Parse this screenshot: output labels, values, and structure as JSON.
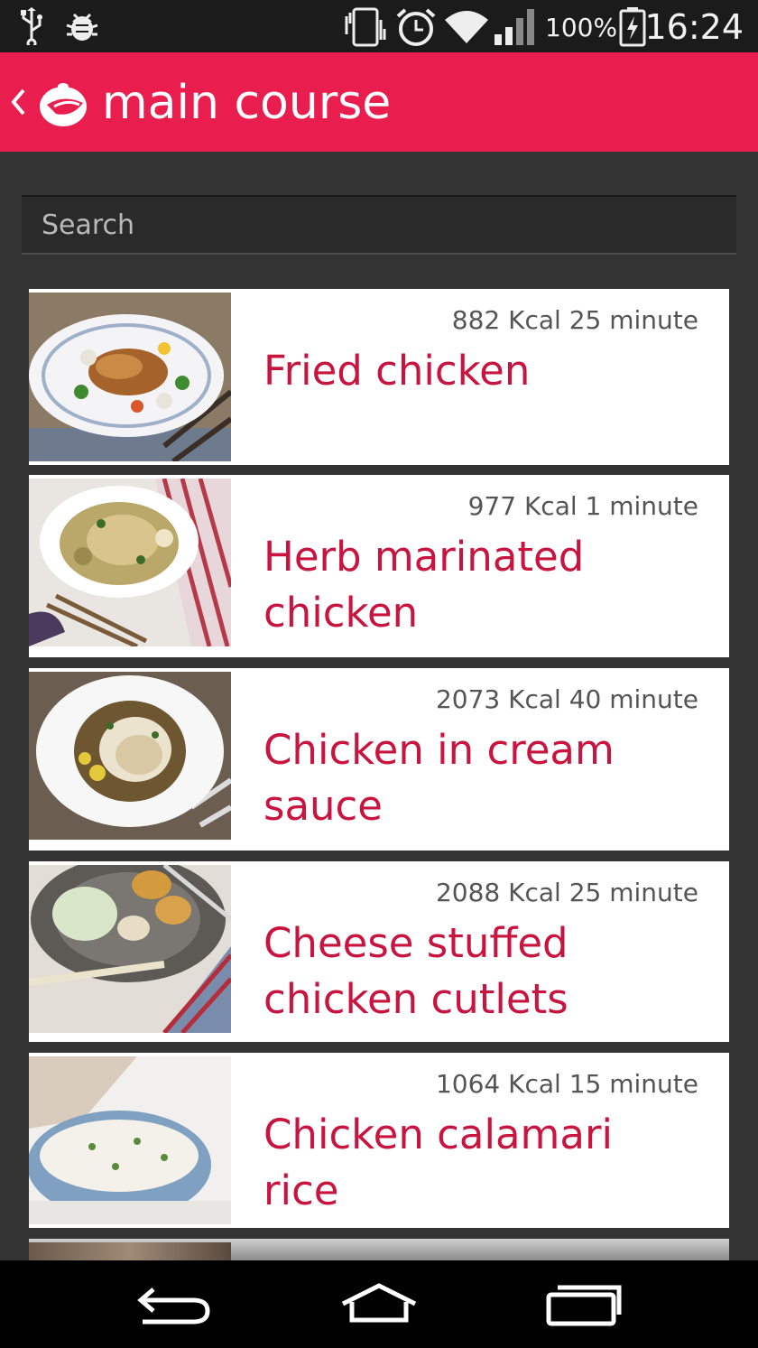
{
  "status_bar": {
    "battery_percent": "100%",
    "time": "16:24",
    "icons": [
      "usb-icon",
      "debug-icon",
      "vibrate-icon",
      "alarm-icon",
      "wifi-icon",
      "signal-icon",
      "battery-charging-icon"
    ]
  },
  "app_bar": {
    "title": "main course",
    "back_icon": "chevron-left-icon",
    "logo_icon": "pot-logo-icon",
    "color": "#e91e4f"
  },
  "search": {
    "placeholder": "Search",
    "value": ""
  },
  "recipes": [
    {
      "meta": "882 Kcal 25 minute",
      "name": "Fried chicken"
    },
    {
      "meta": "977 Kcal 1 minute",
      "name": "Herb marinated chicken"
    },
    {
      "meta": "2073 Kcal 40 minute",
      "name": "Chicken in cream sauce"
    },
    {
      "meta": "2088 Kcal 25 minute",
      "name": "Cheese stuffed chicken cutlets"
    },
    {
      "meta": "1064 Kcal 15 minute",
      "name": "Chicken calamari rice"
    }
  ],
  "nav_bar": {
    "buttons": [
      "back-icon",
      "home-icon",
      "recents-icon"
    ]
  },
  "colors": {
    "accent": "#e91e4f",
    "recipe_title": "#c8143f",
    "background": "#333333"
  }
}
